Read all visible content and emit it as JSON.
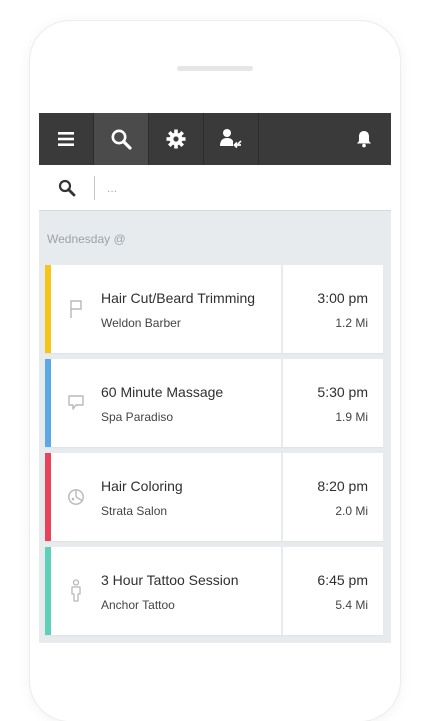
{
  "toolbar": {
    "buttons": [
      {
        "icon": "menu-icon"
      },
      {
        "icon": "search-icon",
        "active": true
      },
      {
        "icon": "gear-icon"
      },
      {
        "icon": "user-share-icon"
      }
    ],
    "bell_icon": "bell-icon",
    "color": "#3a3a3a"
  },
  "search": {
    "placeholder": "..."
  },
  "day_label": "Wednesday @",
  "appointments": [
    {
      "title": "Hair Cut/Beard Trimming",
      "place": "Weldon Barber",
      "time": "3:00 pm",
      "distance": "1.2 Mi",
      "color": "#f5c518",
      "icon": "flag-icon"
    },
    {
      "title": "60 Minute Massage",
      "place": "Spa Paradiso",
      "time": "5:30 pm",
      "distance": "1.9 Mi",
      "color": "#5aa9e6",
      "icon": "chat-bubble-icon"
    },
    {
      "title": "Hair Coloring",
      "place": "Strata Salon",
      "time": "8:20 pm",
      "distance": "2.0 Mi",
      "color": "#e8435a",
      "icon": "palette-icon"
    },
    {
      "title": "3 Hour Tattoo Session",
      "place": "Anchor Tattoo",
      "time": "6:45 pm",
      "distance": "5.4 Mi",
      "color": "#5ecfb8",
      "icon": "person-icon"
    }
  ]
}
